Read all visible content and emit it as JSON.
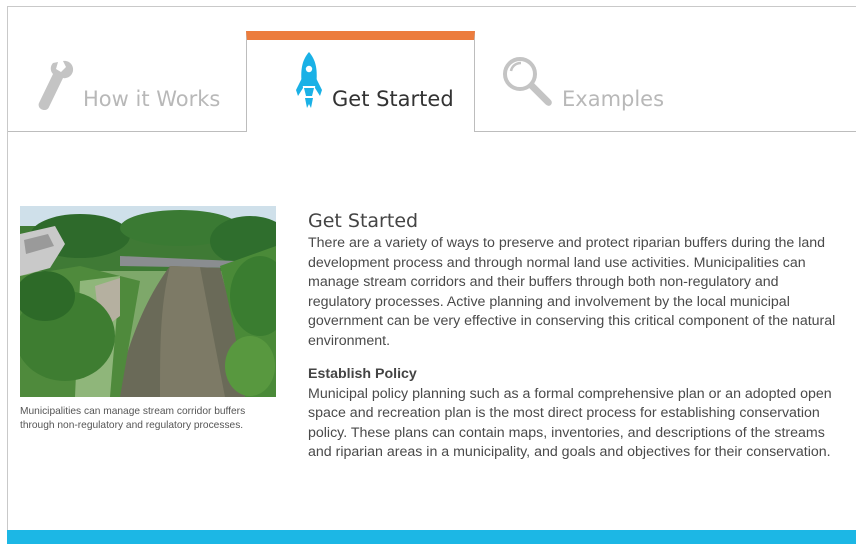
{
  "tabs": [
    {
      "label": "How it Works",
      "icon": "wrench-icon",
      "active": false
    },
    {
      "label": "Get Started",
      "icon": "rocket-icon",
      "active": true
    },
    {
      "label": "Examples",
      "icon": "magnifier-icon",
      "active": false
    }
  ],
  "colors": {
    "active_tab_accent": "#ec7c3d",
    "rocket": "#1ab1e6",
    "footer_bar": "#1cb7e5",
    "inactive_icon": "#c4c4c4"
  },
  "photo": {
    "caption": "Municipalities can manage stream corridor buffers through non-regulatory and regulatory processes."
  },
  "content": {
    "title": "Get Started",
    "intro": "There are a variety of ways to preserve and protect riparian buffers during the land development process and through normal land use activities. Municipalities can manage stream corridors and their buffers through both non-regulatory and regulatory processes. Active planning and involvement by the local municipal government can be very effective in conserving this critical component of the natural environment.",
    "section_heading": "Establish Policy",
    "section_body": "Municipal policy planning such as a formal comprehensive plan or an adopted open space and recreation plan is the most direct process for establishing conservation policy. These plans can contain maps, inventories, and descriptions of the streams and riparian areas in a municipality, and goals and objectives for their conservation."
  }
}
